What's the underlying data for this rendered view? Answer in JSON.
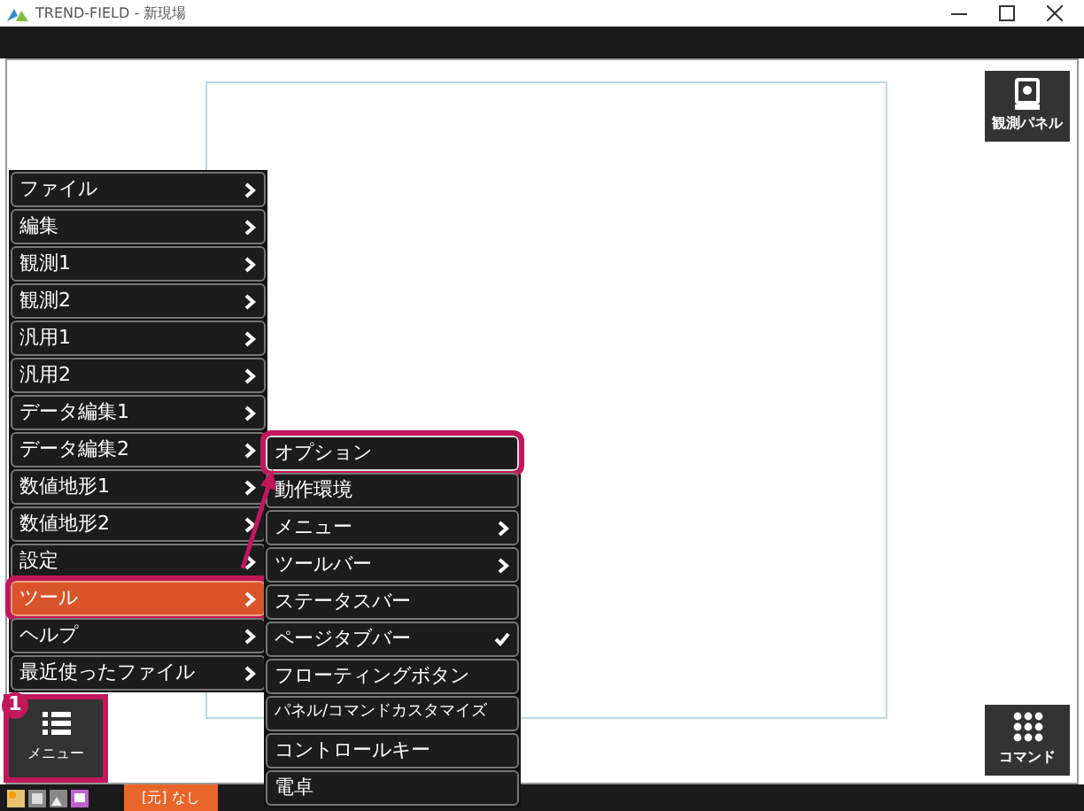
{
  "window": {
    "title": "TREND-FIELD - 新現場"
  },
  "main_menu": {
    "items": [
      {
        "label": "ファイル",
        "selected": false,
        "highlighted": false
      },
      {
        "label": "編集",
        "selected": false,
        "highlighted": false
      },
      {
        "label": "観測1",
        "selected": false,
        "highlighted": false
      },
      {
        "label": "観測2",
        "selected": false,
        "highlighted": false
      },
      {
        "label": "汎用1",
        "selected": false,
        "highlighted": false
      },
      {
        "label": "汎用2",
        "selected": false,
        "highlighted": false
      },
      {
        "label": "データ編集1",
        "selected": false,
        "highlighted": false
      },
      {
        "label": "データ編集2",
        "selected": false,
        "highlighted": false
      },
      {
        "label": "数値地形1",
        "selected": false,
        "highlighted": false
      },
      {
        "label": "数値地形2",
        "selected": false,
        "highlighted": false
      },
      {
        "label": "設定",
        "selected": false,
        "highlighted": false
      },
      {
        "label": "ツール",
        "selected": true,
        "highlighted": true
      },
      {
        "label": "ヘルプ",
        "selected": false,
        "highlighted": false
      },
      {
        "label": "最近使ったファイル",
        "selected": false,
        "highlighted": false
      }
    ]
  },
  "tool_submenu": {
    "items": [
      {
        "label": "オプション",
        "kind": "plain",
        "highlighted": true
      },
      {
        "label": "動作環境",
        "kind": "plain",
        "highlighted": false
      },
      {
        "label": "メニュー",
        "kind": "submenu",
        "highlighted": false
      },
      {
        "label": "ツールバー",
        "kind": "submenu",
        "highlighted": false
      },
      {
        "label": "ステータスバー",
        "kind": "check",
        "checked": false,
        "highlighted": false
      },
      {
        "label": "ページタブバー",
        "kind": "check",
        "checked": true,
        "highlighted": false
      },
      {
        "label": "フローティングボタン",
        "kind": "plain",
        "highlighted": false
      },
      {
        "label": "パネル/コマンドカスタマイズ",
        "kind": "plain",
        "highlighted": false
      },
      {
        "label": "コントロールキー",
        "kind": "plain",
        "highlighted": false
      },
      {
        "label": "電卓",
        "kind": "plain",
        "highlighted": false
      }
    ]
  },
  "menu_button": {
    "label": "メニュー",
    "highlighted": true,
    "step_badge": "1"
  },
  "panel_button": {
    "label": "観測パネル"
  },
  "command_button": {
    "label": "コマンド"
  },
  "status_bar": {
    "page_label": "[元] なし"
  }
}
